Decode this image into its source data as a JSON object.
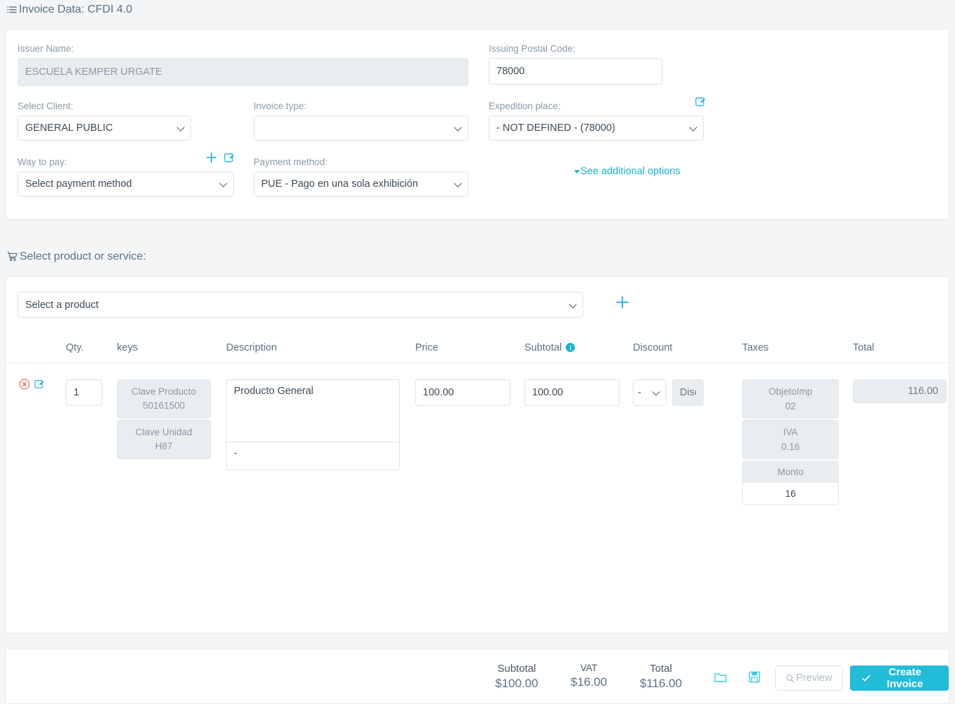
{
  "invoice_section": {
    "title": "Invoice Data: CFDI 4.0",
    "icon": "list-icon",
    "issuer_name_label": "Issuer Name:",
    "issuer_name_value": "ESCUELA KEMPER URGATE",
    "postal_code_label": "Issuing Postal Code:",
    "postal_code_value": "78000",
    "postal_code_edit_icon": "edit-square-icon",
    "select_client_label": "Select Client:",
    "select_client_value": "GENERAL PUBLIC",
    "add_client_icon": "plus-icon",
    "edit_client_icon": "edit-square-icon",
    "invoice_type_label": "Invoice type:",
    "invoice_type_value": "",
    "expedition_place_label": "Expedition place:",
    "expedition_place_value": "- NOT DEFINED - (78000)",
    "way_to_pay_label": "Way to pay:",
    "way_to_pay_value": "Select payment method",
    "payment_method_label": "Payment method:",
    "payment_method_value": "PUE - Pago en una sola exhibición",
    "additional_options_link": "See additional options"
  },
  "product_section": {
    "title": "Select product or service:",
    "icon": "cart-icon",
    "select_product_value": "Select a product",
    "add_product_icon": "plus-icon",
    "columns": [
      "Qty.",
      "keys",
      "Description",
      "Price",
      "Subtotal",
      "Discount",
      "Taxes",
      "Total"
    ],
    "subtotal_info_icon": "info-icon",
    "rows": [
      {
        "delete_icon": "delete-circle-icon",
        "edit_icon": "edit-square-icon",
        "qty": "1",
        "keys": [
          {
            "label": "Clave Producto",
            "value": "50161500"
          },
          {
            "label": "Clave Unidad",
            "value": "H87"
          }
        ],
        "description": "Producto General",
        "description_extra": "-",
        "price": "100.00",
        "subtotal": "100.00",
        "discount_type": "-",
        "discount_placeholder": "Discount",
        "taxes": [
          {
            "label": "ObjetoImp",
            "value": "02",
            "editable": false
          },
          {
            "label": "IVA",
            "value": "0.16",
            "editable": false
          },
          {
            "label": "Monto",
            "value": "16",
            "editable": true
          }
        ],
        "total": "116.00"
      }
    ]
  },
  "footer": {
    "subtotal_label": "Subtotal",
    "subtotal_value": "$100.00",
    "vat_label": "VAT",
    "vat_value": "$16.00",
    "total_label": "Total",
    "total_value": "$116.00",
    "folder_icon": "folder-icon",
    "save_icon": "save-disk-icon",
    "preview_label": "Preview",
    "preview_icon": "search-icon",
    "create_label": "Create Invoice",
    "create_icon": "check-icon"
  },
  "colors": {
    "accent": "#22bcd9",
    "link": "#17b2d4",
    "page_bg": "#f4f5f7",
    "danger": "#f4685f"
  }
}
